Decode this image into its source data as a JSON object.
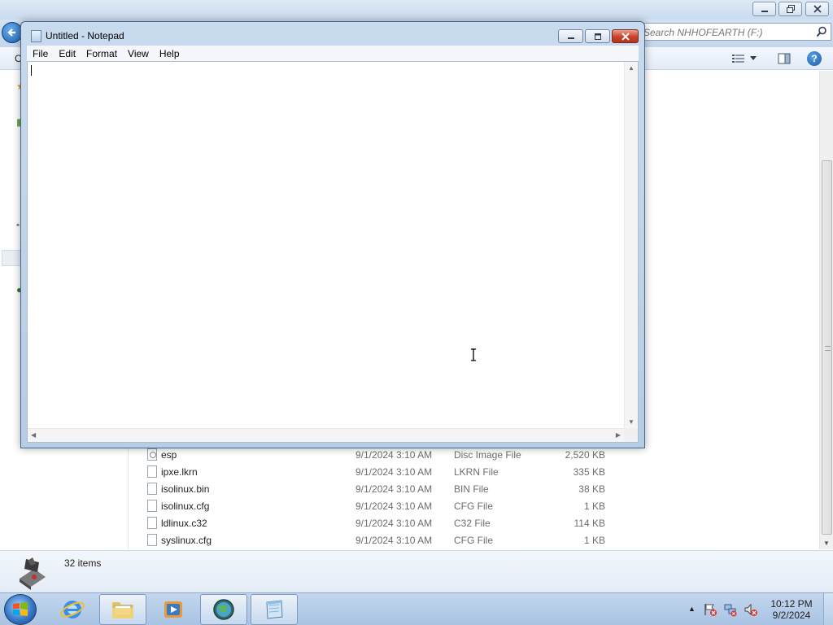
{
  "explorer": {
    "search": {
      "placeholder": "Search NHHOFEARTH (F:)"
    },
    "toolbar": {
      "organize_label": "O"
    },
    "help_label": "?",
    "files": [
      {
        "name": "esp",
        "date": "9/1/2024 3:10 AM",
        "type": "Disc Image File",
        "size": "2,520 KB",
        "icon": "disc-image-file-icon"
      },
      {
        "name": "ipxe.lkrn",
        "date": "9/1/2024 3:10 AM",
        "type": "LKRN File",
        "size": "335 KB",
        "icon": "file-icon"
      },
      {
        "name": "isolinux.bin",
        "date": "9/1/2024 3:10 AM",
        "type": "BIN File",
        "size": "38 KB",
        "icon": "file-icon"
      },
      {
        "name": "isolinux.cfg",
        "date": "9/1/2024 3:10 AM",
        "type": "CFG File",
        "size": "1 KB",
        "icon": "file-icon"
      },
      {
        "name": "ldlinux.c32",
        "date": "9/1/2024 3:10 AM",
        "type": "C32 File",
        "size": "114 KB",
        "icon": "file-icon"
      },
      {
        "name": "syslinux.cfg",
        "date": "9/1/2024 3:10 AM",
        "type": "CFG File",
        "size": "1 KB",
        "icon": "file-icon"
      }
    ],
    "status": {
      "items_count": "32 items"
    }
  },
  "notepad": {
    "title": "Untitled - Notepad",
    "menu": [
      "File",
      "Edit",
      "Format",
      "View",
      "Help"
    ],
    "content": ""
  },
  "taskbar": {
    "pinned": [
      {
        "name": "internet-explorer",
        "icon": "internet-explorer-icon"
      },
      {
        "name": "windows-explorer",
        "icon": "folder-icon"
      },
      {
        "name": "media-player",
        "icon": "media-player-icon"
      },
      {
        "name": "browser",
        "icon": "globe-icon"
      },
      {
        "name": "notepad",
        "icon": "notepad-icon"
      }
    ],
    "clock": {
      "time": "10:12 PM",
      "date": "9/2/2024"
    }
  },
  "colors": {
    "titlebar": "#c8daee",
    "close_button": "#c8412a",
    "taskbar": "#b6cde8",
    "accent": "#1c5fb0"
  }
}
